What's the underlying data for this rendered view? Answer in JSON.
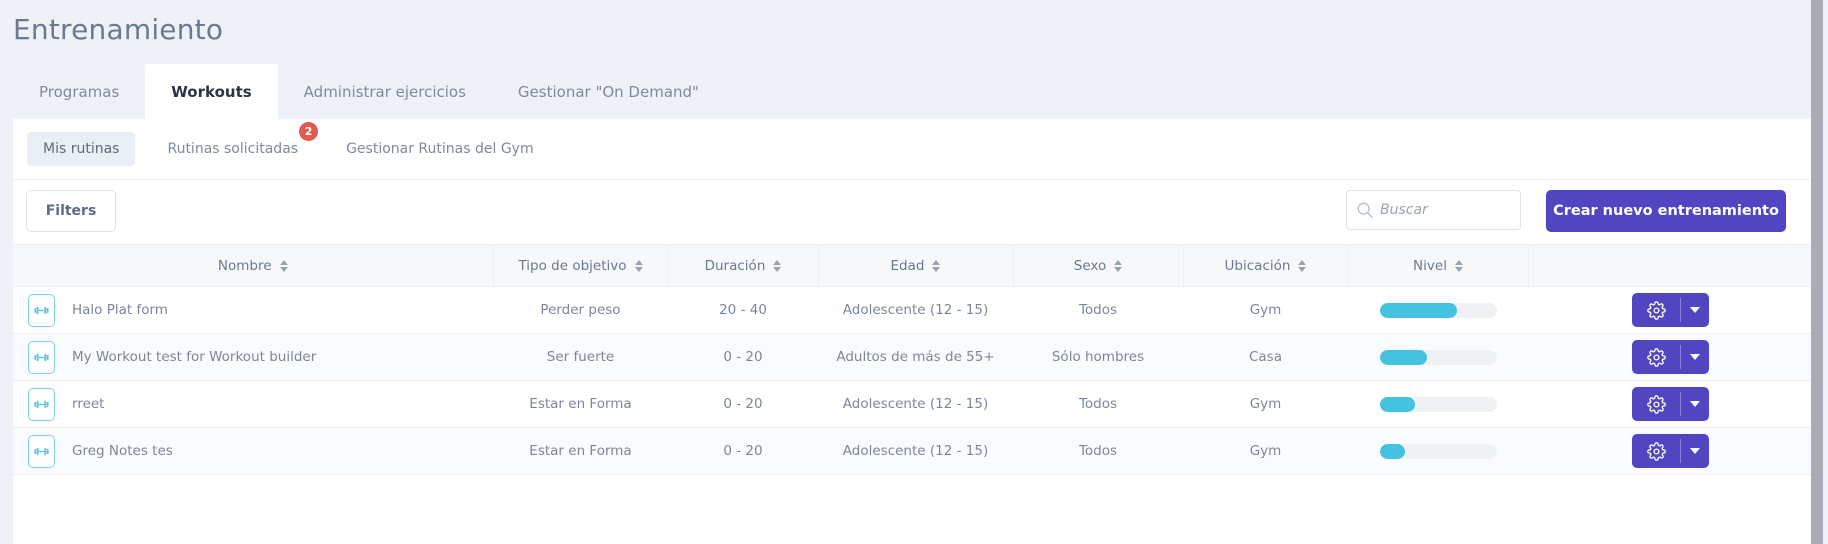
{
  "page": {
    "title": "Entrenamiento"
  },
  "tabs": [
    {
      "label": "Programas",
      "active": false
    },
    {
      "label": "Workouts",
      "active": true
    },
    {
      "label": "Administrar ejercicios",
      "active": false
    },
    {
      "label": "Gestionar \"On Demand\"",
      "active": false
    }
  ],
  "subtabs": [
    {
      "label": "Mis rutinas",
      "active": true,
      "badge": null
    },
    {
      "label": "Rutinas solicitadas",
      "active": false,
      "badge": "2"
    },
    {
      "label": "Gestionar Rutinas del Gym",
      "active": false,
      "badge": null
    }
  ],
  "toolbar": {
    "filters_label": "Filters",
    "search_placeholder": "Buscar",
    "search_value": "",
    "search_icon": "search-icon",
    "create_label": "Crear nuevo entrenamiento"
  },
  "table": {
    "columns": [
      {
        "label": "Nombre",
        "sortable": true
      },
      {
        "label": "Tipo de objetivo",
        "sortable": true
      },
      {
        "label": "Duración",
        "sortable": true
      },
      {
        "label": "Edad",
        "sortable": true
      },
      {
        "label": "Sexo",
        "sortable": true
      },
      {
        "label": "Ubicación",
        "sortable": true
      },
      {
        "label": "Nivel",
        "sortable": true
      },
      {
        "label": "",
        "sortable": false
      }
    ],
    "rows": [
      {
        "icon": "dumbbell-icon",
        "nombre": "Halo Plat form",
        "tipo_de_objetivo": "Perder peso",
        "duracion": "20 - 40",
        "edad": "Adolescente (12 - 15)",
        "sexo": "Todos",
        "ubicacion": "Gym",
        "nivel_percent": 66,
        "action_icon": "gear-icon",
        "caret_icon": "chevron-down-icon"
      },
      {
        "icon": "dumbbell-icon",
        "nombre": "My Workout test for Workout builder",
        "tipo_de_objetivo": "Ser fuerte",
        "duracion": "0 - 20",
        "edad": "Adultos de más de 55+",
        "sexo": "Sólo hombres",
        "ubicacion": "Casa",
        "nivel_percent": 41,
        "action_icon": "gear-icon",
        "caret_icon": "chevron-down-icon"
      },
      {
        "icon": "dumbbell-icon",
        "nombre": "rreet",
        "tipo_de_objetivo": "Estar en Forma",
        "duracion": "0 - 20",
        "edad": "Adolescente (12 - 15)",
        "sexo": "Todos",
        "ubicacion": "Gym",
        "nivel_percent": 30,
        "action_icon": "gear-icon",
        "caret_icon": "chevron-down-icon"
      },
      {
        "icon": "dumbbell-icon",
        "nombre": "Greg Notes tes",
        "tipo_de_objetivo": "Estar en Forma",
        "duracion": "0 - 20",
        "edad": "Adolescente (12 - 15)",
        "sexo": "Todos",
        "ubicacion": "Gym",
        "nivel_percent": 22,
        "action_icon": "gear-icon",
        "caret_icon": "chevron-down-icon"
      }
    ]
  },
  "colors": {
    "page_bg": "#eef2f8",
    "card_bg": "#ffffff",
    "accent_purple": "#5145c2",
    "accent_cyan": "#45c2e0",
    "badge_red": "#e05a4f",
    "text_muted": "#7b8798",
    "header_bg": "#f6f8fa"
  }
}
